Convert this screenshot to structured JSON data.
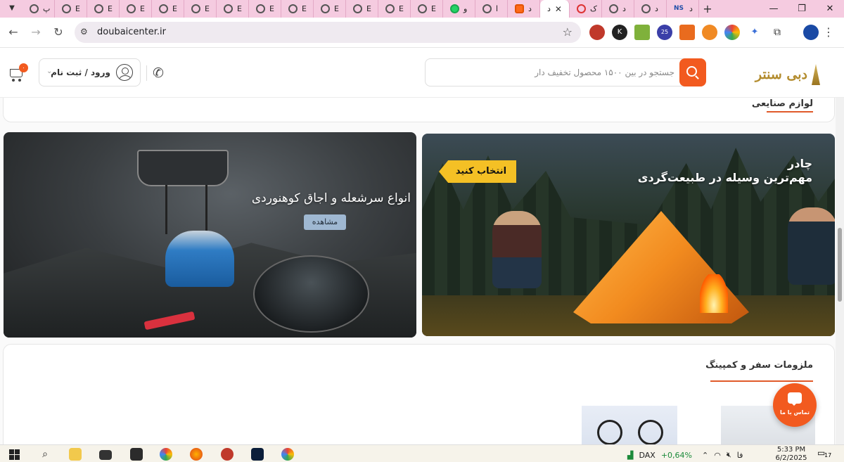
{
  "browser": {
    "tabs": [
      {
        "letter": "پ",
        "icon": "globe-icon"
      },
      {
        "letter": "E",
        "icon": "globe-icon"
      },
      {
        "letter": "E",
        "icon": "globe-icon"
      },
      {
        "letter": "E",
        "icon": "globe-icon"
      },
      {
        "letter": "E",
        "icon": "globe-icon"
      },
      {
        "letter": "E",
        "icon": "globe-icon"
      },
      {
        "letter": "E",
        "icon": "globe-icon"
      },
      {
        "letter": "E",
        "icon": "globe-icon"
      },
      {
        "letter": "E",
        "icon": "globe-icon"
      },
      {
        "letter": "E",
        "icon": "globe-icon"
      },
      {
        "letter": "E",
        "icon": "globe-icon"
      },
      {
        "letter": "E",
        "icon": "globe-icon"
      },
      {
        "letter": "E",
        "icon": "globe-icon"
      },
      {
        "letter": "و",
        "icon": "whatsapp-icon"
      },
      {
        "letter": "ا",
        "icon": "globe-icon"
      },
      {
        "letter": "د",
        "icon": "orange-app-icon"
      },
      {
        "letter": "د",
        "icon": "active",
        "active": true
      },
      {
        "letter": "ک",
        "icon": "red-app-icon"
      },
      {
        "letter": "د",
        "icon": "globe-icon"
      },
      {
        "letter": "د",
        "icon": "globe-icon"
      },
      {
        "letter": "د",
        "icon": "ns-icon"
      }
    ],
    "new_tab": "+",
    "close_tab": "✕",
    "url": "doubaicenter.ir",
    "extension_badge": "25",
    "window_minimize": "—",
    "window_restore": "❐",
    "window_close": "✕"
  },
  "header": {
    "logo_text": "دبی سنتر",
    "search_placeholder": "جستجو در بین ۱۵۰۰ محصول تخفیف دار",
    "login_label": "ورود / ثبت نام",
    "cart_count": "۰"
  },
  "content": {
    "previous_section_title": "لوازم صنایعی",
    "banner_stove": {
      "title": "انواع سرشعله و اجاق کوهنوردی",
      "button": "مشاهده"
    },
    "banner_tent": {
      "title": "چادر",
      "subtitle": "مهم‌ترین وسیله در طبیعت‌گردی",
      "button": "انتخاب کنید"
    },
    "section_title": "ملزومات سفر و کمپینگ",
    "chat_label": "تماس با ما"
  },
  "taskbar": {
    "ticker": "DAX",
    "ticker_change": "+0,64%",
    "language": "فا",
    "time": "5:33 PM",
    "date": "6/2/2025",
    "notifications": "17"
  },
  "colors": {
    "accent": "#f25a1f",
    "tab_strip": "#f5cbe0",
    "logo_gold": "#b38c2e",
    "choose_button": "#f4c025"
  }
}
